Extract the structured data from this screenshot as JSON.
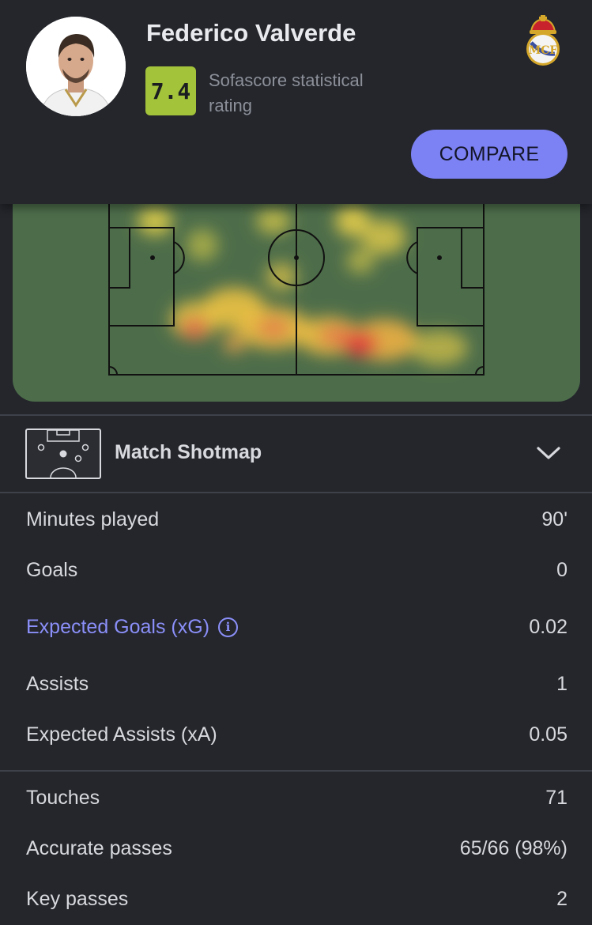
{
  "player": {
    "name": "Federico Valverde",
    "rating": "7.4",
    "rating_label": "Sofascore statistical rating",
    "rating_color": "#a3c33a",
    "avatar_icon": "player-photo",
    "club_icon": "real-madrid-crest"
  },
  "header": {
    "compare_label": "COMPARE",
    "accent_color": "#7c81f3"
  },
  "heatmap": {
    "pitch_color": "#4d6d4a"
  },
  "shotmap": {
    "title": "Match Shotmap",
    "icon": "chevron-down-icon"
  },
  "stats": {
    "group1": [
      {
        "label": "Minutes played",
        "value": "90'"
      },
      {
        "label": "Goals",
        "value": "0"
      },
      {
        "label": "Expected Goals (xG)",
        "value": "0.02",
        "link": true,
        "info_icon": "info-icon"
      },
      {
        "label": "Assists",
        "value": "1"
      },
      {
        "label": "Expected Assists (xA)",
        "value": "0.05"
      }
    ],
    "group2": [
      {
        "label": "Touches",
        "value": "71"
      },
      {
        "label": "Accurate passes",
        "value": "65/66 (98%)"
      },
      {
        "label": "Key passes",
        "value": "2"
      }
    ]
  }
}
